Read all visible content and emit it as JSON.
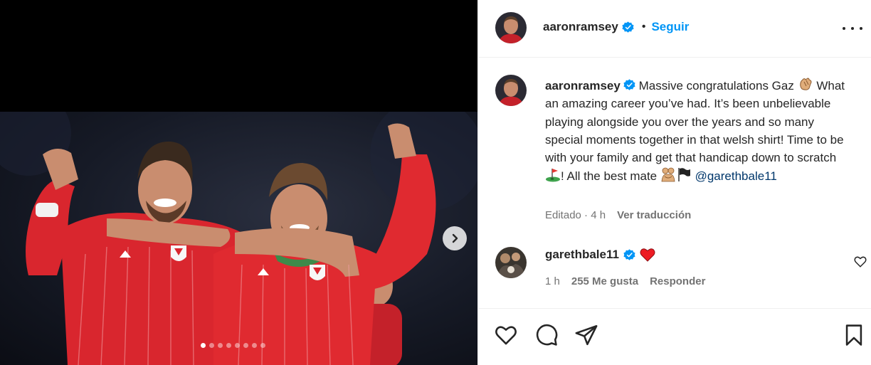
{
  "post": {
    "author": "aaronramsey",
    "follow_label": "Seguir",
    "separator": "•",
    "carousel": {
      "dots_total": 8,
      "active_index": 0
    }
  },
  "caption": {
    "username": "aaronramsey",
    "text_1": "Massive congratulations Gaz",
    "text_2": " What an amazing career you’ve had. It’s been unbelievable playing alongside you over the years and so many special moments together in that welsh shirt! Time to be with your family and get that handicap down to scratch",
    "text_3": "! All the best mate ",
    "mention": "@garethbale11",
    "edited": "Editado · 4 h",
    "translate": "Ver traducción"
  },
  "comment": {
    "username": "garethbale11",
    "time": "1 h",
    "likes": "255 Me gusta",
    "reply": "Responder"
  },
  "icons": {
    "clap": "clapping-hands-emoji",
    "golf": "golf-flag-emoji",
    "hug": "people-hugging-emoji",
    "flag": "black-flag-emoji",
    "heart_red": "red-heart-emoji"
  },
  "colors": {
    "accent": "#0095f6",
    "verified": "#0095f6",
    "mention": "#00376b",
    "kit_red": "#d9262e"
  }
}
